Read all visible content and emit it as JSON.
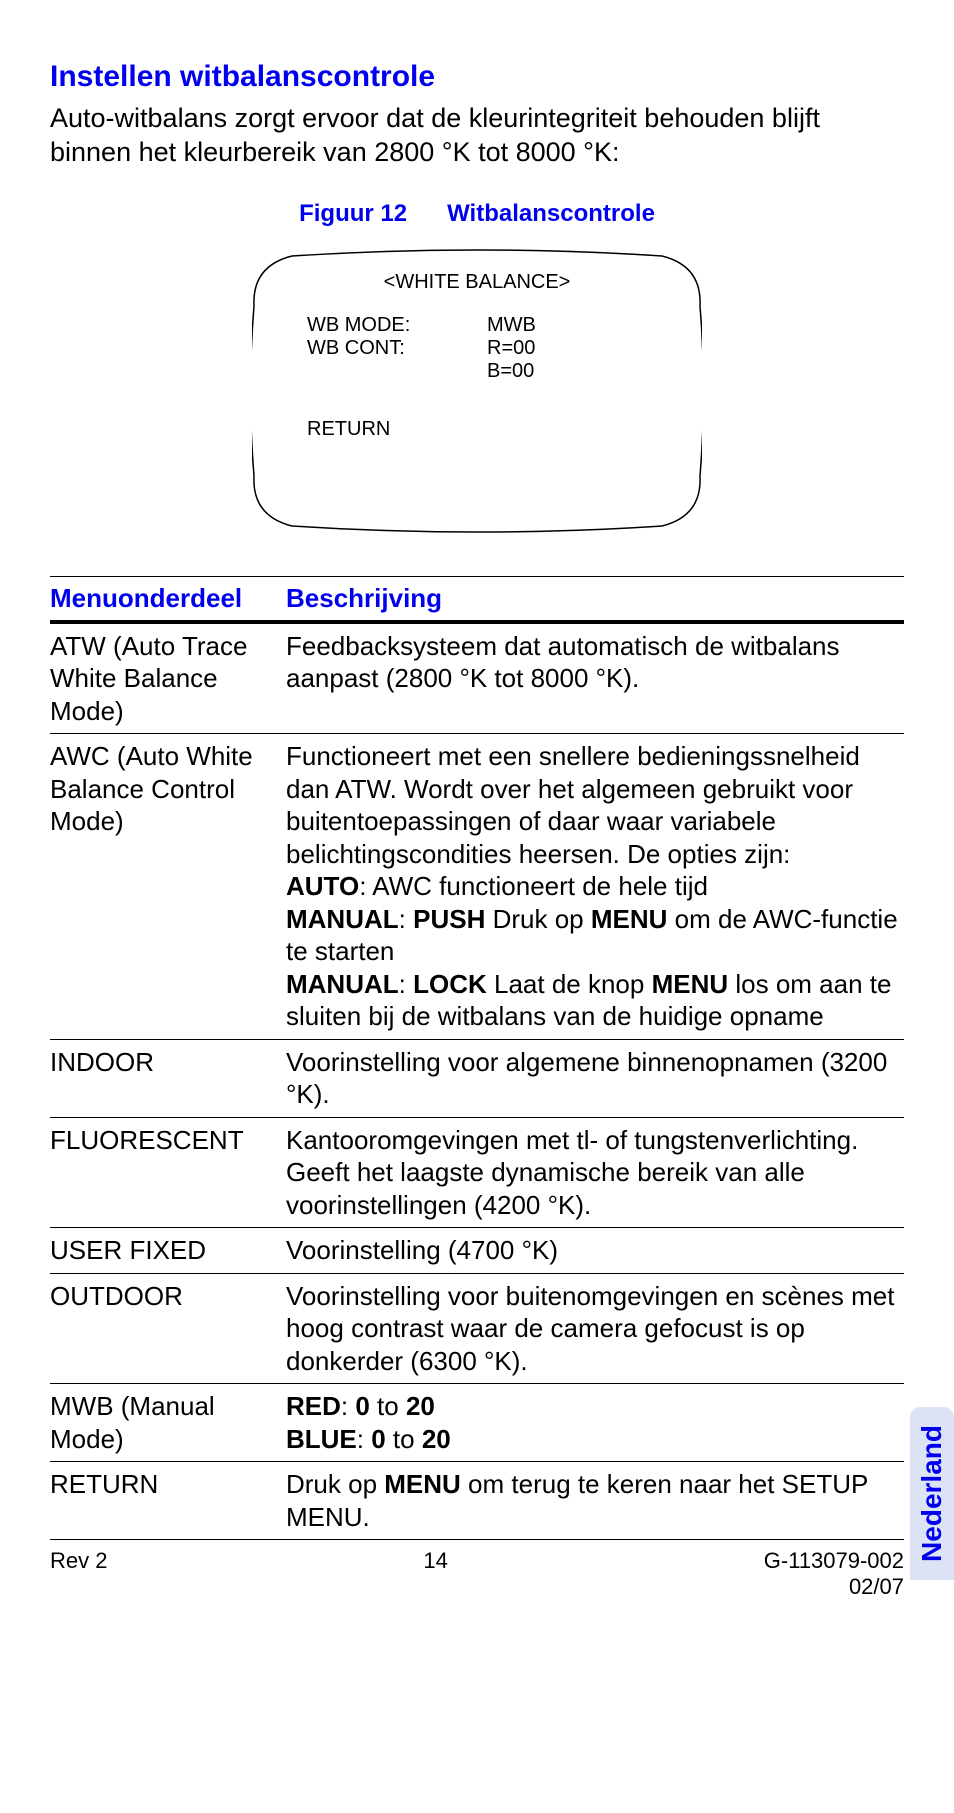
{
  "section_title": "Instellen witbalanscontrole",
  "intro": "Auto-witbalans zorgt ervoor dat de kleurintegriteit behouden blijft binnen het kleurbereik van 2800 °K tot 8000 °K:",
  "figure": {
    "label": "Figuur 12",
    "title": "Witbalanscontrole"
  },
  "crt": {
    "title": "<WHITE BALANCE>",
    "rows": [
      {
        "label": "WB MODE:",
        "value": "MWB"
      },
      {
        "label": "WB CONT:",
        "value": "R=00"
      },
      {
        "label": "",
        "value": "B=00"
      }
    ],
    "return": "RETURN"
  },
  "table": {
    "headers": {
      "col1": "Menuonderdeel",
      "col2": "Beschrijving"
    },
    "rows": [
      {
        "item": "ATW (Auto Trace White Balance Mode)",
        "desc_html": "Feedbacksysteem dat automatisch de witbalans aanpast (2800 °K tot 8000 °K)."
      },
      {
        "item": "AWC (Auto White Balance Control Mode)",
        "desc_html": "Functioneert met een snellere bedieningssnelheid dan ATW. Wordt over het algemeen gebruikt voor buitentoepassingen of daar waar variabele belichtingscondities heersen. De opties zijn:<br><span class=\"b\">AUTO</span>: AWC functioneert de hele tijd<br><span class=\"b\">MANUAL</span>: <span class=\"b\">PUSH</span> Druk op <span class=\"b\">MENU</span> om de AWC-functie te starten<br><span class=\"b\">MANUAL</span>: <span class=\"b\">LOCK</span> Laat de knop <span class=\"b\">MENU</span> los om aan te sluiten bij de witbalans van de huidige opname"
      },
      {
        "item": "INDOOR",
        "desc_html": "Voorinstelling voor algemene binnenopnamen (3200 °K)."
      },
      {
        "item": "FLUORESCENT",
        "desc_html": "Kantooromgevingen met tl- of tungstenverlichting. Geeft het laagste dynamische bereik van alle voorinstellingen (4200 °K)."
      },
      {
        "item": "USER FIXED",
        "desc_html": "Voorinstelling (4700 °K)"
      },
      {
        "item": "OUTDOOR",
        "desc_html": "Voorinstelling voor buitenomgevingen en scènes met hoog contrast waar de camera gefocust is op donkerder (6300 °K)."
      },
      {
        "item": "MWB (Manual Mode)",
        "desc_html": "<span class=\"b\">RED</span>: <span class=\"b\">0</span> to <span class=\"b\">20</span><br><span class=\"b\">BLUE</span>: <span class=\"b\">0</span> to <span class=\"b\">20</span>"
      },
      {
        "item": "RETURN",
        "desc_html": "Druk op <span class=\"b\">MENU</span> om terug te keren naar het SETUP MENU."
      }
    ]
  },
  "footer": {
    "rev": "Rev 2",
    "page": "14",
    "docnum": "G-113079-002",
    "date": "02/07"
  },
  "side_tab": "Nederland"
}
